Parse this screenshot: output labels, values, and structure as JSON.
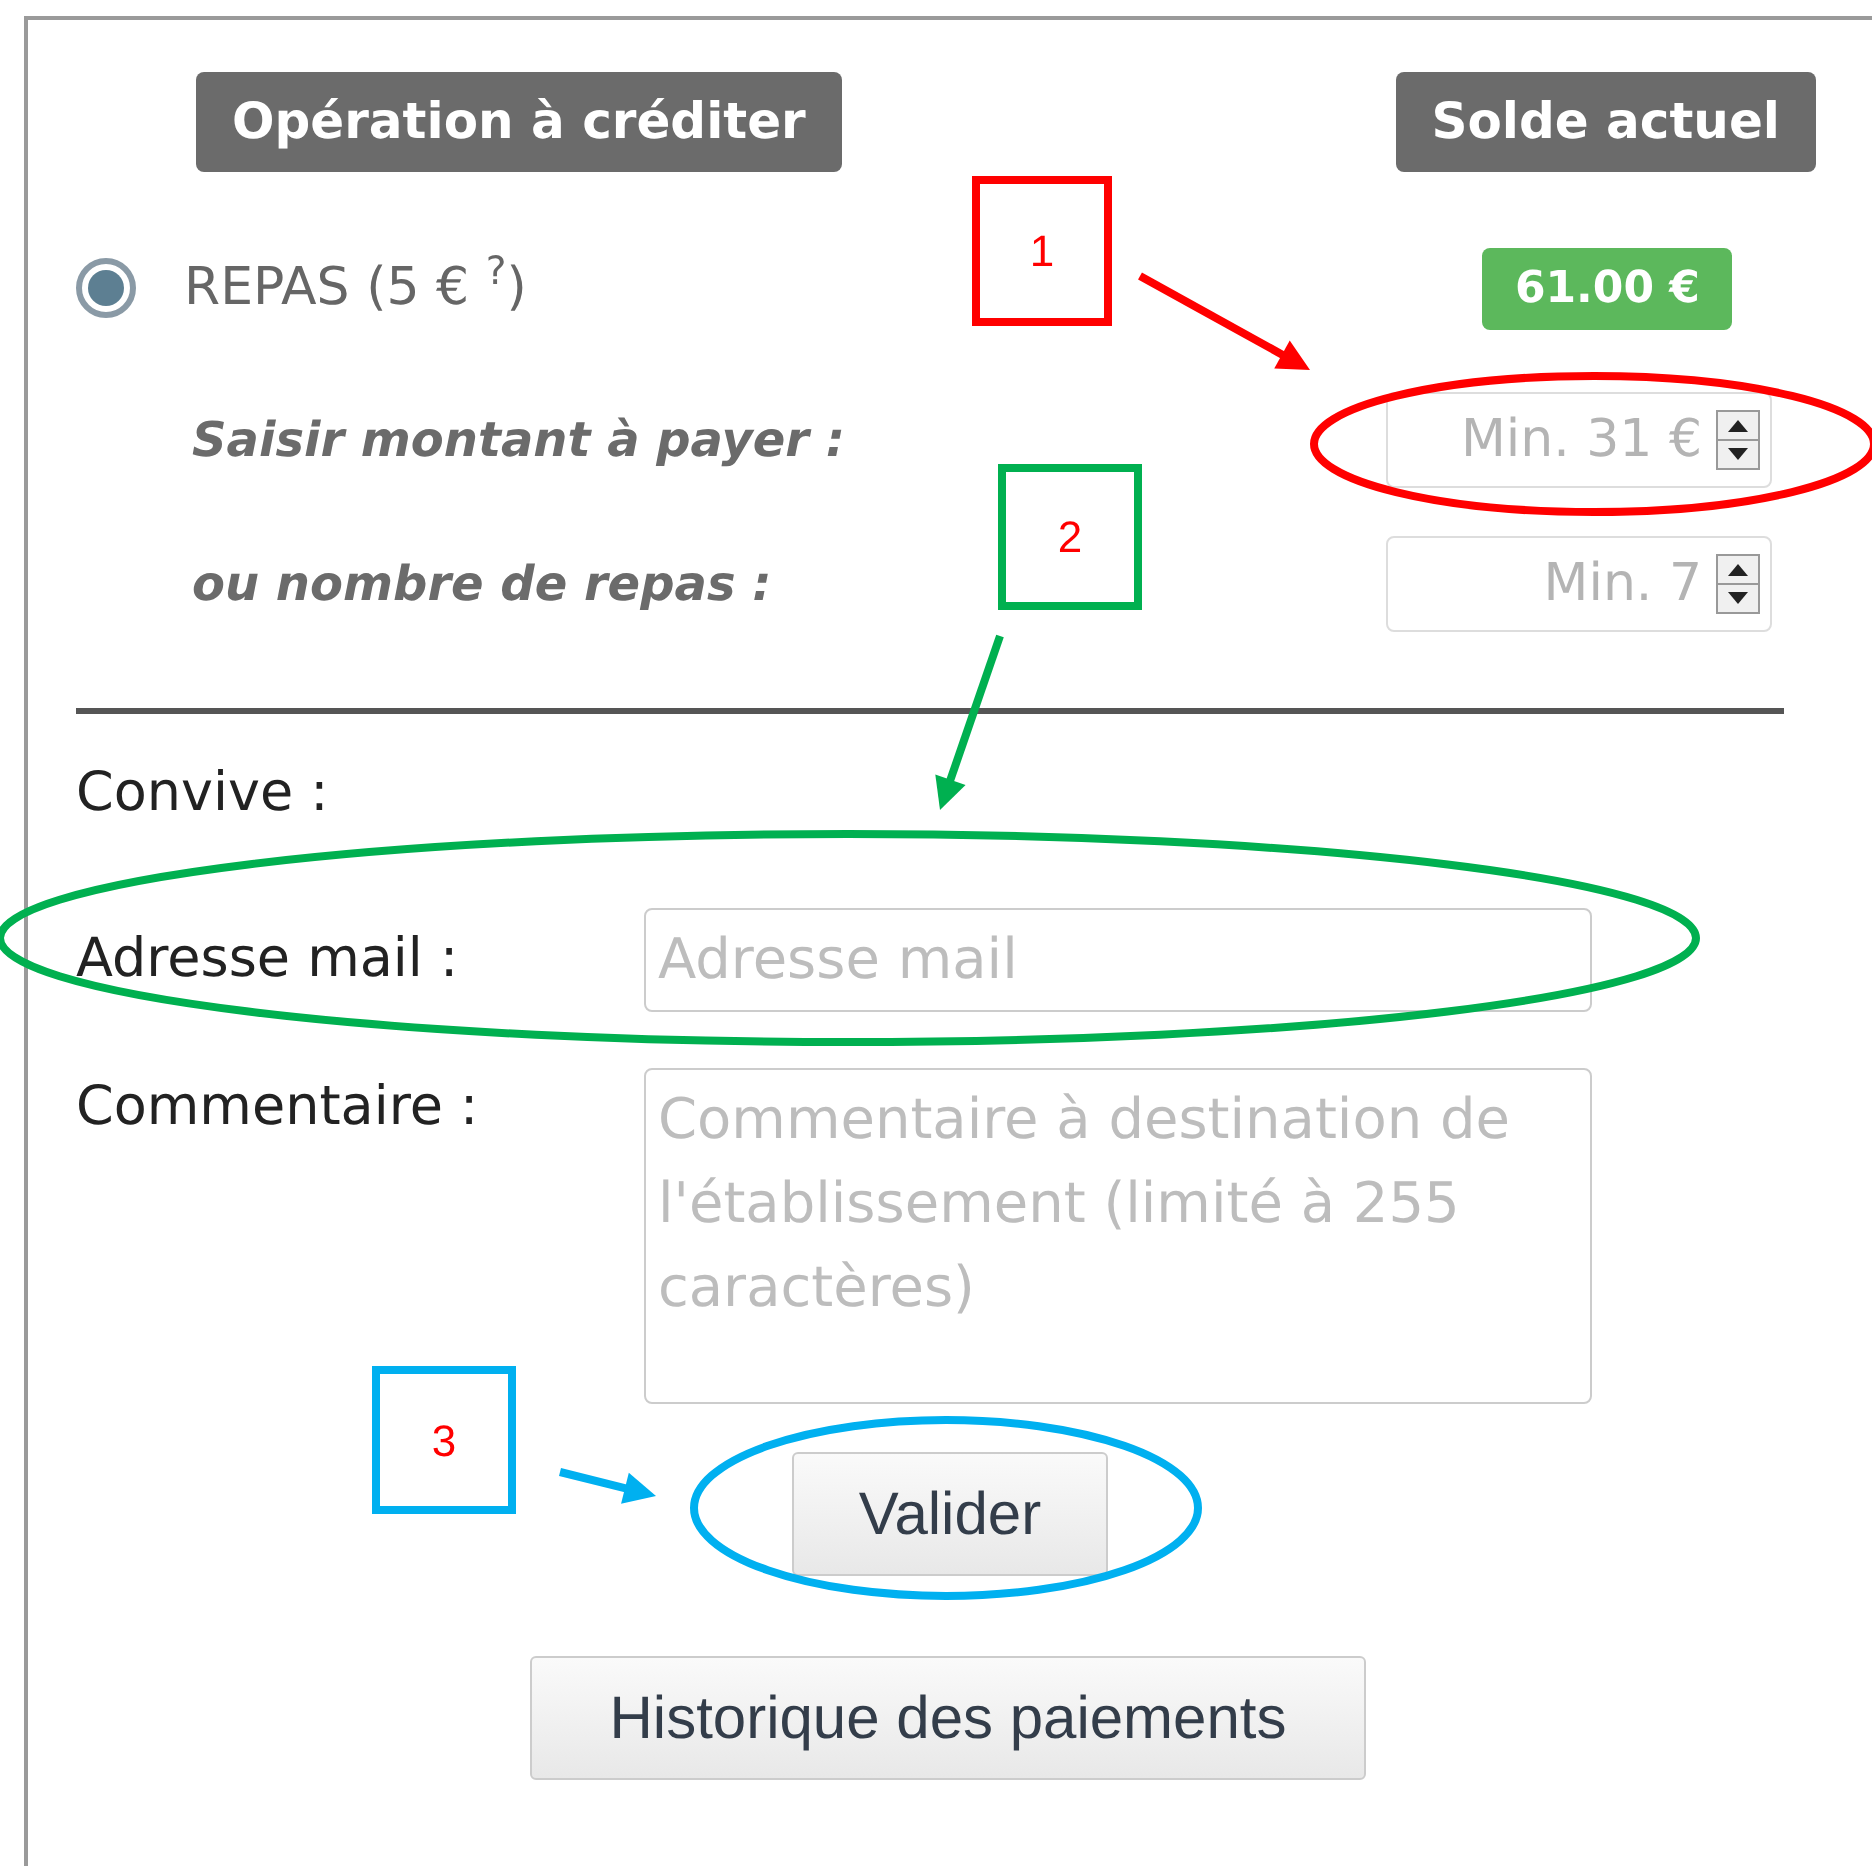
{
  "headers": [
    "Opération à créditer",
    "Solde actuel"
  ],
  "option": {
    "label": "REPAS (5 € $^{?}$)",
    "selected": true
  },
  "balance": "61.00 €",
  "amount_fields": [
    {
      "label": "Saisir montant à payer :",
      "placeholder": "Min. 31 €"
    },
    {
      "label": "ou nombre de repas :",
      "placeholder": "Min. 7"
    }
  ],
  "guest_label": "Convive :",
  "email": {
    "label": "Adresse mail :",
    "placeholder": "Adresse mail"
  },
  "comment": {
    "label": "Commentaire :",
    "placeholder": "Commentaire à destination de l'établissement (limité à 255 caractères)"
  },
  "buttons": [
    "Valider",
    "Historique des paiements"
  ],
  "annotations": [
    {
      "label": "1",
      "color": "#ff0000"
    },
    {
      "label": "2",
      "color": "#00b050"
    },
    {
      "label": "3",
      "color": "#00b0f0"
    }
  ]
}
